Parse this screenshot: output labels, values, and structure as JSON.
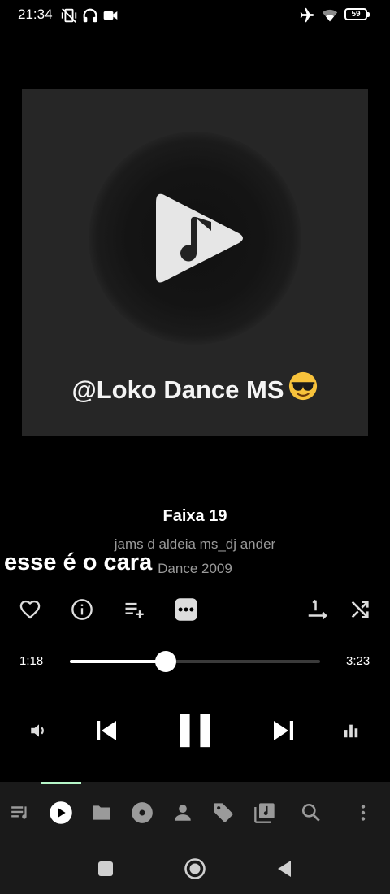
{
  "status_bar": {
    "time": "21:34",
    "battery": "59",
    "icons": [
      "mute-vibrate-icon",
      "headset-icon",
      "video-camera-icon",
      "airplane-icon",
      "wifi-icon",
      "battery-icon"
    ]
  },
  "album_art": {
    "caption": "@Loko Dance MS",
    "caption_emoji": "sunglasses-emoji",
    "logo": "music-play-logo"
  },
  "track": {
    "title": "Faixa 19",
    "artist": "jams d aldeia ms_dj ander",
    "album": "Dance 2009"
  },
  "lyric_overlay": "esse é o cara",
  "actions": [
    "favorite-heart-icon",
    "info-icon",
    "add-to-playlist-icon",
    "more-options-icon",
    "repeat-one-icon",
    "shuffle-icon"
  ],
  "progress": {
    "elapsed": "1:18",
    "total": "3:23",
    "fraction": 0.384
  },
  "controls": [
    "volume-icon",
    "previous-track-icon",
    "pause-icon",
    "next-track-icon",
    "equalizer-icon"
  ],
  "bottom_nav": {
    "active_index": 1,
    "items": [
      "queue-icon",
      "now-playing-icon",
      "folder-icon",
      "album-disc-icon",
      "artist-icon",
      "tag-icon",
      "library-icon",
      "search-icon",
      "overflow-menu-icon"
    ]
  },
  "colors": {
    "background": "#000000",
    "art_background": "#262626",
    "accent": "#b6f5c8",
    "nav_background": "#1a1a1a",
    "secondary_text": "#9a9a9a"
  }
}
